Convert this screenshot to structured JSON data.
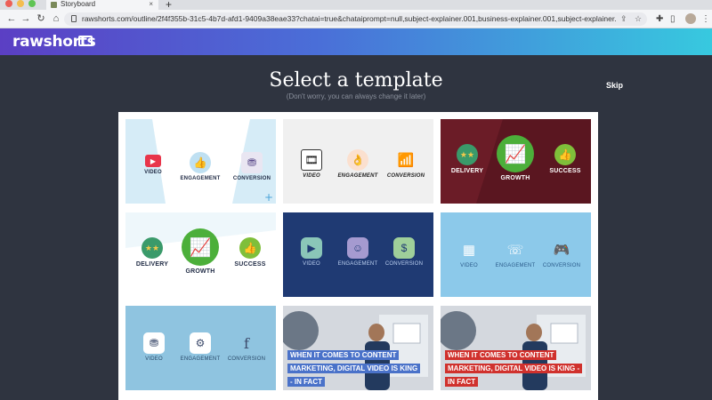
{
  "browser": {
    "tab_title": "Storyboard",
    "tab_close": "×",
    "new_tab": "+",
    "url": "rawshorts.com/outline/2f4f355b-31c5-4b7d-afd1-9409a38eae33?chatai=true&chataiprompt=null,subject-explainer.001,business-explainer.001,subject-explainer.001,..."
  },
  "app": {
    "logo": "rawshorts"
  },
  "page": {
    "title": "Select a template",
    "subtitle": "(Don't worry, you can always change it later)",
    "skip": "Skip"
  },
  "templates": [
    {
      "labels": [
        "VIDEO",
        "ENGAGEMENT",
        "CONVERSION"
      ]
    },
    {
      "labels": [
        "VIDEO",
        "ENGAGEMENT",
        "CONVERSION"
      ]
    },
    {
      "labels": [
        "DELIVERY",
        "GROWTH",
        "SUCCESS"
      ]
    },
    {
      "labels": [
        "DELIVERY",
        "GROWTH",
        "SUCCESS"
      ]
    },
    {
      "labels": [
        "VIDEO",
        "ENGAGEMENT",
        "CONVERSION"
      ]
    },
    {
      "labels": [
        "VIDEO",
        "ENGAGEMENT",
        "CONVERSION"
      ]
    },
    {
      "labels": [
        "VIDEO",
        "ENGAGEMENT",
        "CONVERSION"
      ]
    },
    {
      "caption": [
        "WHEN IT COMES TO CONTENT",
        "MARKETING, DIGITAL VIDEO IS KING",
        "- IN FACT"
      ]
    },
    {
      "caption": [
        "WHEN IT COMES TO CONTENT",
        "MARKETING, DIGITAL VIDEO IS KING -",
        "IN FACT"
      ]
    }
  ],
  "colors": {
    "brand_gradient_start": "#5b3fc4",
    "brand_gradient_end": "#37c9df",
    "page_bg": "#2f3440",
    "growth_green": "#4caf3a",
    "caption_blue": "#4a72c9",
    "caption_red": "#d0312d"
  }
}
